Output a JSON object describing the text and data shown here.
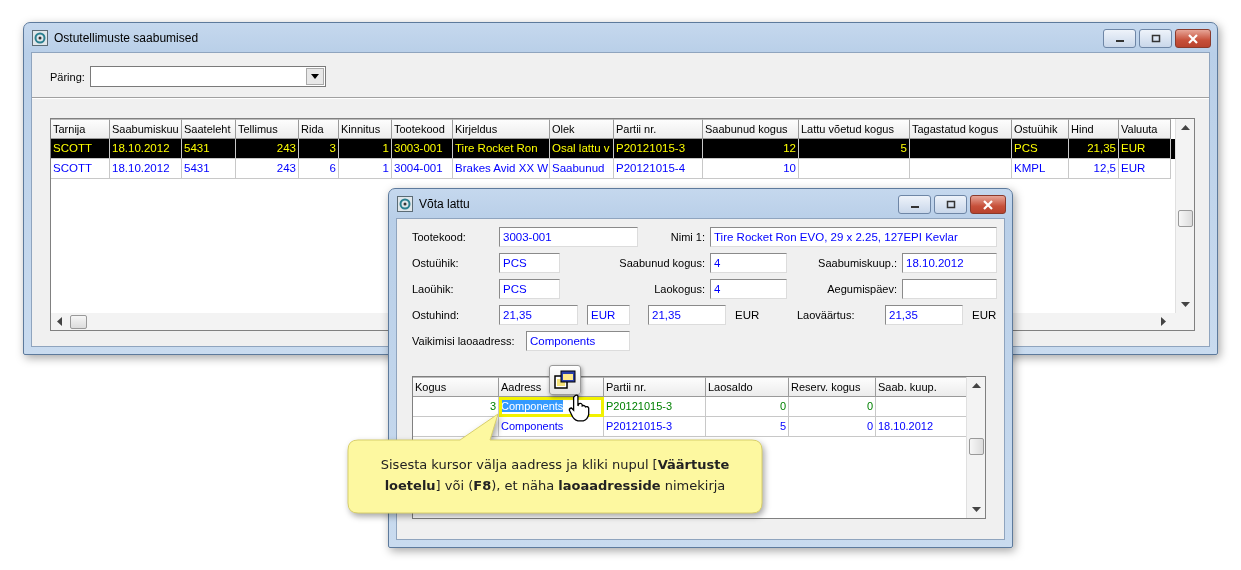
{
  "main_window": {
    "title": "Ostutellimuste saabumised",
    "query": {
      "label": "Päring:"
    },
    "table": {
      "columns": [
        "Tarnija",
        "Saabumiskuu",
        "Saateleht",
        "Tellimus",
        "Rida",
        "Kinnitus",
        "Tootekood",
        "Kirjeldus",
        "Olek",
        "Partii nr.",
        "Saabunud kogus",
        "Lattu võetud kogus",
        "Tagastatud kogus",
        "Ostuühik",
        "Hind",
        "Valuuta"
      ],
      "rows": [
        {
          "selected": true,
          "cells": [
            "SCOTT",
            "18.10.2012",
            "5431",
            "243",
            "3",
            "1",
            "3003-001",
            "Tire Rocket Ron",
            "Osal lattu v",
            "P20121015-3",
            "12",
            "5",
            null,
            "PCS",
            "21,35",
            "EUR"
          ]
        },
        {
          "selected": false,
          "cells": [
            "SCOTT",
            "18.10.2012",
            "5431",
            "243",
            "6",
            "1",
            "3004-001",
            "Brakes Avid XX W",
            "Saabunud",
            "P20121015-4",
            "10",
            null,
            null,
            "KMPL",
            "12,5",
            "EUR"
          ]
        }
      ]
    }
  },
  "dialog": {
    "title": "Võta lattu",
    "form": {
      "tootekood": {
        "label": "Tootekood:",
        "value": "3003-001"
      },
      "nimi": {
        "label": "Nimi 1:",
        "value": "Tire Rocket Ron EVO, 29 x 2.25, 127EPI Kevlar"
      },
      "ostuyhik": {
        "label": "Ostuühik:",
        "value": "PCS"
      },
      "saabunud_kogus": {
        "label": "Saabunud kogus:",
        "value": "4"
      },
      "saabumiskuup": {
        "label": "Saabumiskuup.:",
        "value": "18.10.2012"
      },
      "laoyhik": {
        "label": "Laoühik:",
        "value": "PCS"
      },
      "laokogus": {
        "label": "Laokogus:",
        "value": "4"
      },
      "aegumispaev": {
        "label": "Aegumispäev:"
      },
      "ostuhind": {
        "label": "Ostuhind:",
        "value": "21,35",
        "currency": "EUR"
      },
      "ostuhind_converted": {
        "value": "21,35",
        "currency": "EUR"
      },
      "laovaartus": {
        "label": "Laoväärtus:",
        "value": "21,35",
        "currency": "EUR"
      },
      "vaikimisi_laoaadress": {
        "label": "Vaikimisi laoaadress:",
        "value": "Components"
      }
    },
    "table": {
      "columns": [
        "Kogus",
        "Aadress",
        "Partii nr.",
        "Laosaldo",
        "Reserv. kogus",
        "Saab. kuup."
      ],
      "rows": [
        {
          "color": "#008000",
          "cells": [
            {
              "text": "3",
              "selected": false
            },
            {
              "text": "Components",
              "selected": true
            },
            {
              "text": "P20121015-3",
              "selected": false
            },
            {
              "text": "0",
              "selected": false
            },
            {
              "text": "0",
              "selected": false
            },
            {
              "selected": false
            }
          ]
        },
        {
          "color": "#0000ff",
          "cells": [
            {
              "selected": false
            },
            {
              "text": "Components",
              "selected": false
            },
            {
              "text": "P20121015-3",
              "selected": false
            },
            {
              "text": "5",
              "selected": false
            },
            {
              "text": "0",
              "selected": false
            },
            {
              "text": "18.10.2012",
              "selected": false
            }
          ]
        }
      ]
    }
  },
  "callout": {
    "text": "Sisesta kursor välja aadress ja kliki nupul [**Väärtuste loetelu**] või (**F8**), et näha **laoaadresside** nimekirja"
  }
}
